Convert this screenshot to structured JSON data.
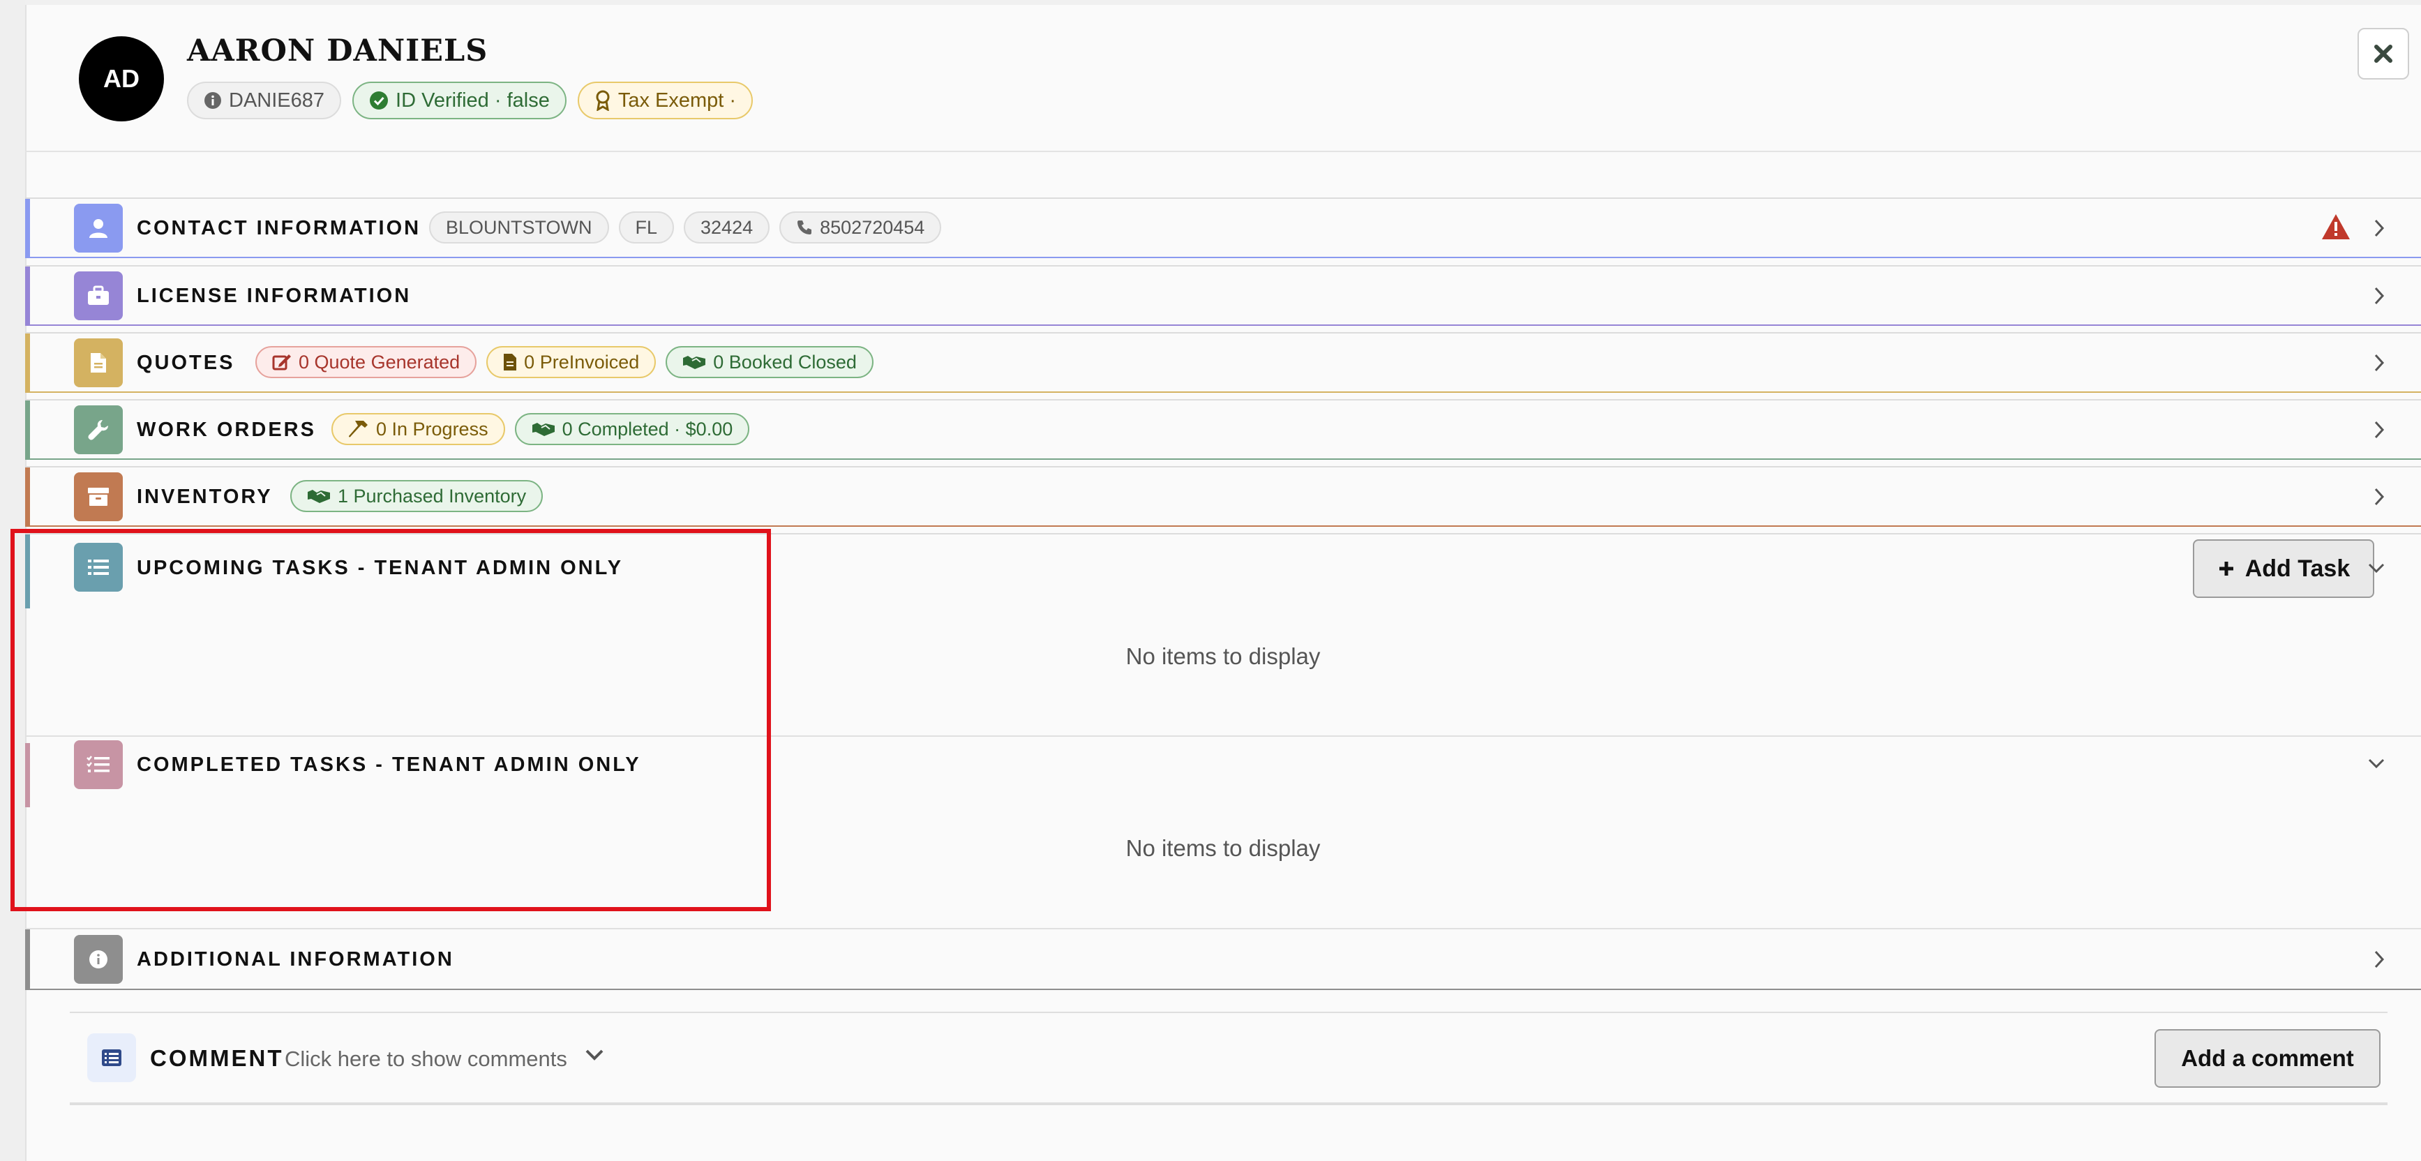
{
  "header": {
    "initials": "AD",
    "name": "AARON DANIELS",
    "badges": {
      "account_id": "DANIE687",
      "id_verified": "ID Verified · false",
      "tax_exempt": "Tax Exempt ·"
    }
  },
  "sections": {
    "contact": {
      "title": "CONTACT INFORMATION",
      "city": "BLOUNTSTOWN",
      "state": "FL",
      "zip": "32424",
      "phone": "8502720454"
    },
    "license": {
      "title": "LICENSE INFORMATION"
    },
    "quotes": {
      "title": "QUOTES",
      "generated": "0 Quote Generated",
      "preinvoiced": "0 PreInvoiced",
      "booked": "0 Booked Closed"
    },
    "work_orders": {
      "title": "WORK ORDERS",
      "in_progress": "0 In Progress",
      "completed": "0 Completed · $0.00"
    },
    "inventory": {
      "title": "INVENTORY",
      "purchased": "1 Purchased Inventory"
    },
    "upcoming_tasks": {
      "title": "UPCOMING TASKS - TENANT ADMIN ONLY",
      "add_label": "Add Task",
      "empty": "No items to display"
    },
    "completed_tasks": {
      "title": "COMPLETED TASKS - TENANT ADMIN ONLY",
      "empty": "No items to display"
    },
    "additional": {
      "title": "ADDITIONAL INFORMATION"
    }
  },
  "comment": {
    "title": "COMMENT",
    "hint": "Click here to show comments",
    "add_label": "Add a comment"
  },
  "colors": {
    "contact": "#8a9af0",
    "license": "#9685d6",
    "quotes": "#d4b261",
    "work_orders": "#78a58a",
    "inventory": "#c17a52",
    "upcoming_tasks": "#6a9fae",
    "completed_tasks": "#c794a4",
    "additional": "#8e8e8e",
    "highlight": "#e0121b"
  }
}
